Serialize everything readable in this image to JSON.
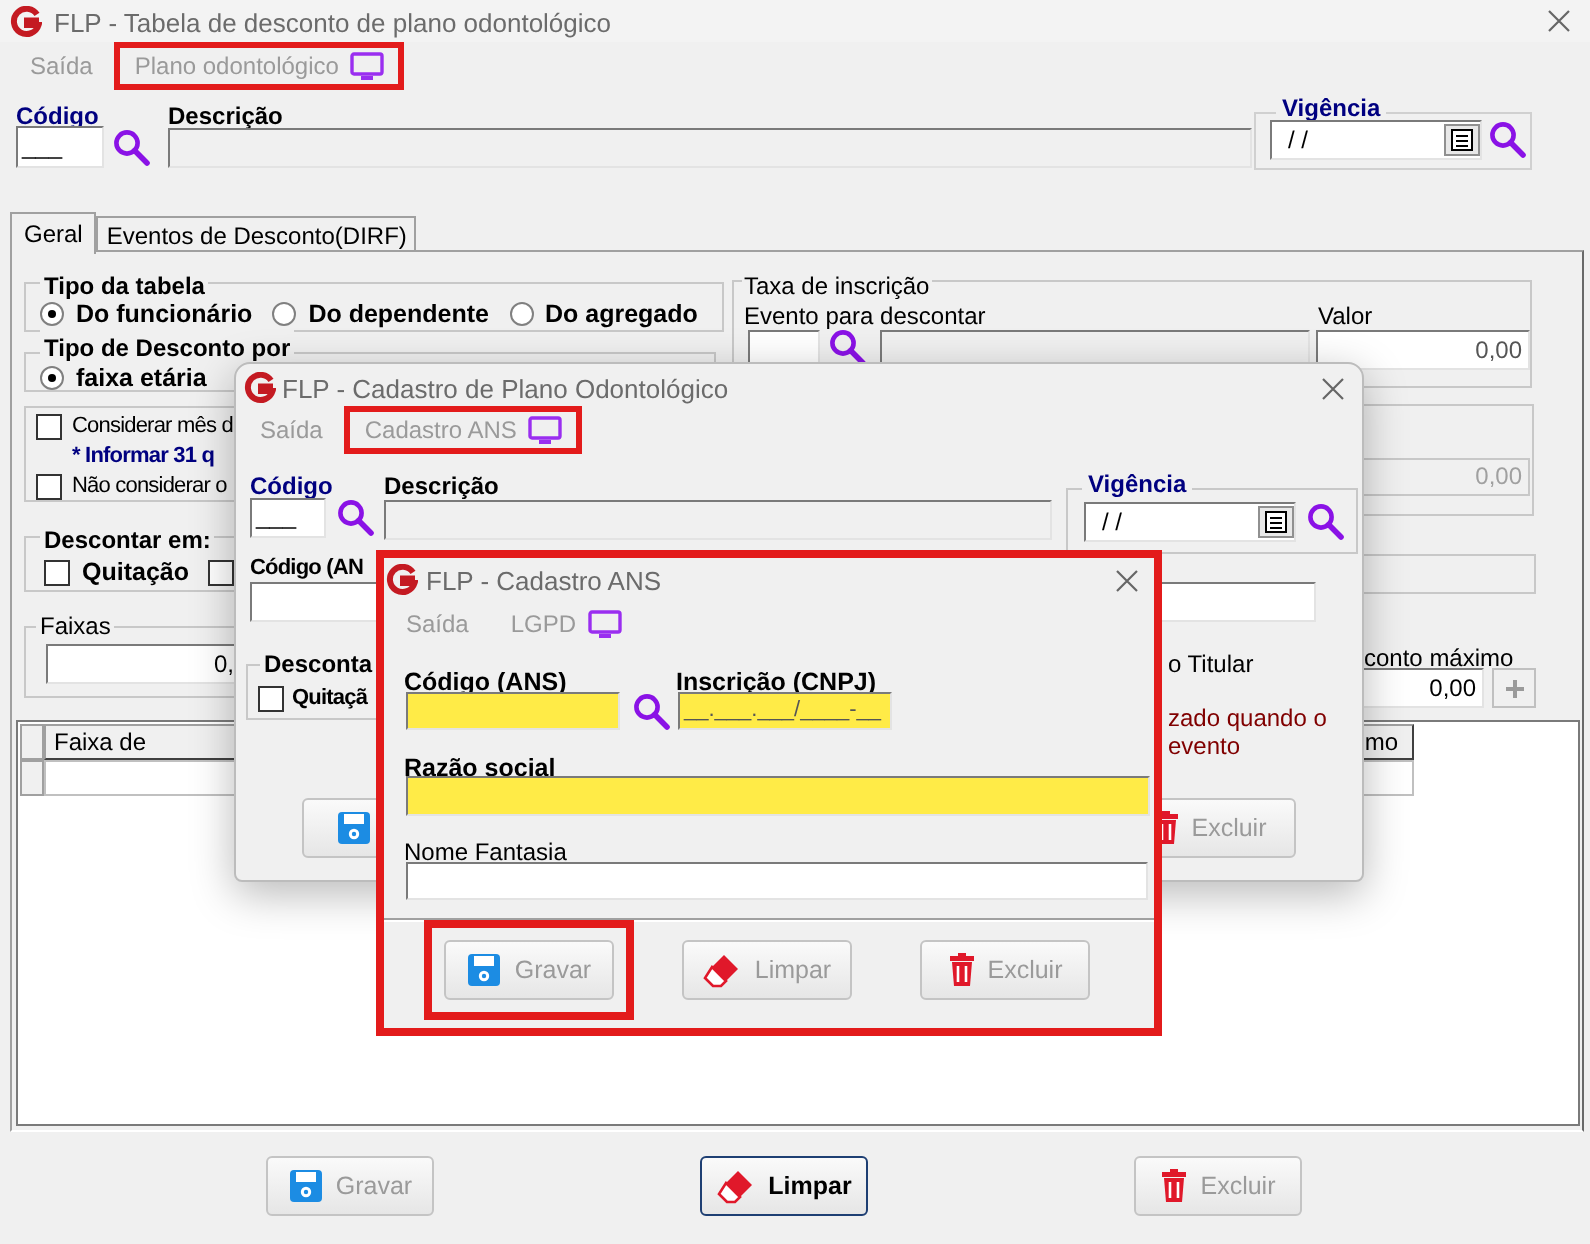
{
  "main_window": {
    "title": "FLP - Tabela de desconto de plano odontológico",
    "menu": [
      {
        "label": "Saída",
        "kind": "text",
        "highlighted": false
      },
      {
        "label": "Plano odontológico",
        "kind": "screen",
        "highlighted": true
      }
    ],
    "codigo": {
      "label": "Código",
      "value": "___"
    },
    "descricao": {
      "label": "Descrição"
    },
    "vigencia": {
      "label": "Vigência",
      "value": "/ /"
    },
    "tabs": [
      {
        "label": "Geral",
        "selected": true
      },
      {
        "label": "Eventos de Desconto(DIRF)",
        "selected": false
      }
    ],
    "tipo_tabela": {
      "label": "Tipo da tabela",
      "options": [
        {
          "label": "Do funcionário",
          "selected": true
        },
        {
          "label": "Do dependente",
          "selected": false
        },
        {
          "label": "Do agregado",
          "selected": false
        }
      ]
    },
    "tipo_desconto": {
      "label": "Tipo de Desconto por",
      "options": [
        {
          "label": "faixa etária",
          "selected": true
        }
      ]
    },
    "opcoes": [
      {
        "kind": "checkbox",
        "label": "Considerar mês d",
        "checked": false
      },
      {
        "kind": "note",
        "label": "* Informar 31 q"
      },
      {
        "kind": "checkbox",
        "label": "Não considerar o",
        "checked": false
      }
    ],
    "descontar_em": {
      "label": "Descontar em:",
      "options": [
        {
          "label": "Quitação",
          "checked": false
        },
        {
          "checked": false
        }
      ]
    },
    "faixas": {
      "label": "Faixas",
      "value": "0,"
    },
    "taxa_inscricao": {
      "label": "Taxa de inscrição",
      "evento_label": "Evento para descontar",
      "valor_label": "Valor",
      "valor": "0,00"
    },
    "field_1": {
      "value": "0,00",
      "disabled": true
    },
    "desconto_maximo": {
      "label": "conto máximo",
      "value": "0,00"
    },
    "table": {
      "columns": [
        {
          "label": "Faixa de"
        },
        {
          "label": "mo"
        }
      ]
    },
    "buttons": [
      {
        "kind": "save",
        "label": "Gravar",
        "disabled": true,
        "focused": false
      },
      {
        "kind": "clear",
        "label": "Limpar",
        "disabled": false,
        "focused": true
      },
      {
        "kind": "delete",
        "label": "Excluir",
        "disabled": true,
        "focused": false
      }
    ]
  },
  "plano_dialog": {
    "title": "FLP - Cadastro de Plano Odontológico",
    "menu": [
      {
        "label": "Saída",
        "kind": "text",
        "highlighted": false
      },
      {
        "label": "Cadastro ANS",
        "kind": "screen",
        "highlighted": true
      }
    ],
    "codigo": {
      "label": "Código",
      "value": "___"
    },
    "descricao": {
      "label": "Descrição"
    },
    "vigencia": {
      "label": "Vigência",
      "value": "/ /"
    },
    "codigo_ans": {
      "label": "Código (AN"
    },
    "descontar": {
      "label": "Desconta",
      "options": [
        {
          "label": "Quitaçã",
          "checked": false
        }
      ]
    },
    "titular_text": "o Titular",
    "note_lines": [
      "zado quando o",
      "evento"
    ],
    "buttons": [
      {
        "kind": "save",
        "disabled": true
      },
      {
        "kind": "delete",
        "label": "Excluir",
        "disabled": true
      }
    ]
  },
  "ans_dialog": {
    "title": "FLP - Cadastro ANS",
    "highlighted": true,
    "menu": [
      {
        "label": "Saída",
        "kind": "text",
        "highlighted": false
      },
      {
        "label": "LGPD",
        "kind": "screen",
        "highlighted": false
      }
    ],
    "codigo_ans": {
      "label": "Código (ANS)",
      "required": true
    },
    "inscricao": {
      "label": "Inscrição (CNPJ)",
      "required": true,
      "value": "__.___.___/____-__"
    },
    "razao_social": {
      "label": "Razão social",
      "required": true
    },
    "nome_fantasia": {
      "label": "Nome Fantasia",
      "required": false
    },
    "buttons": [
      {
        "kind": "save",
        "label": "Gravar",
        "disabled": true,
        "highlighted": true
      },
      {
        "kind": "clear",
        "label": "Limpar",
        "disabled": true,
        "highlighted": false
      },
      {
        "kind": "delete",
        "label": "Excluir",
        "disabled": true,
        "highlighted": false
      }
    ]
  }
}
